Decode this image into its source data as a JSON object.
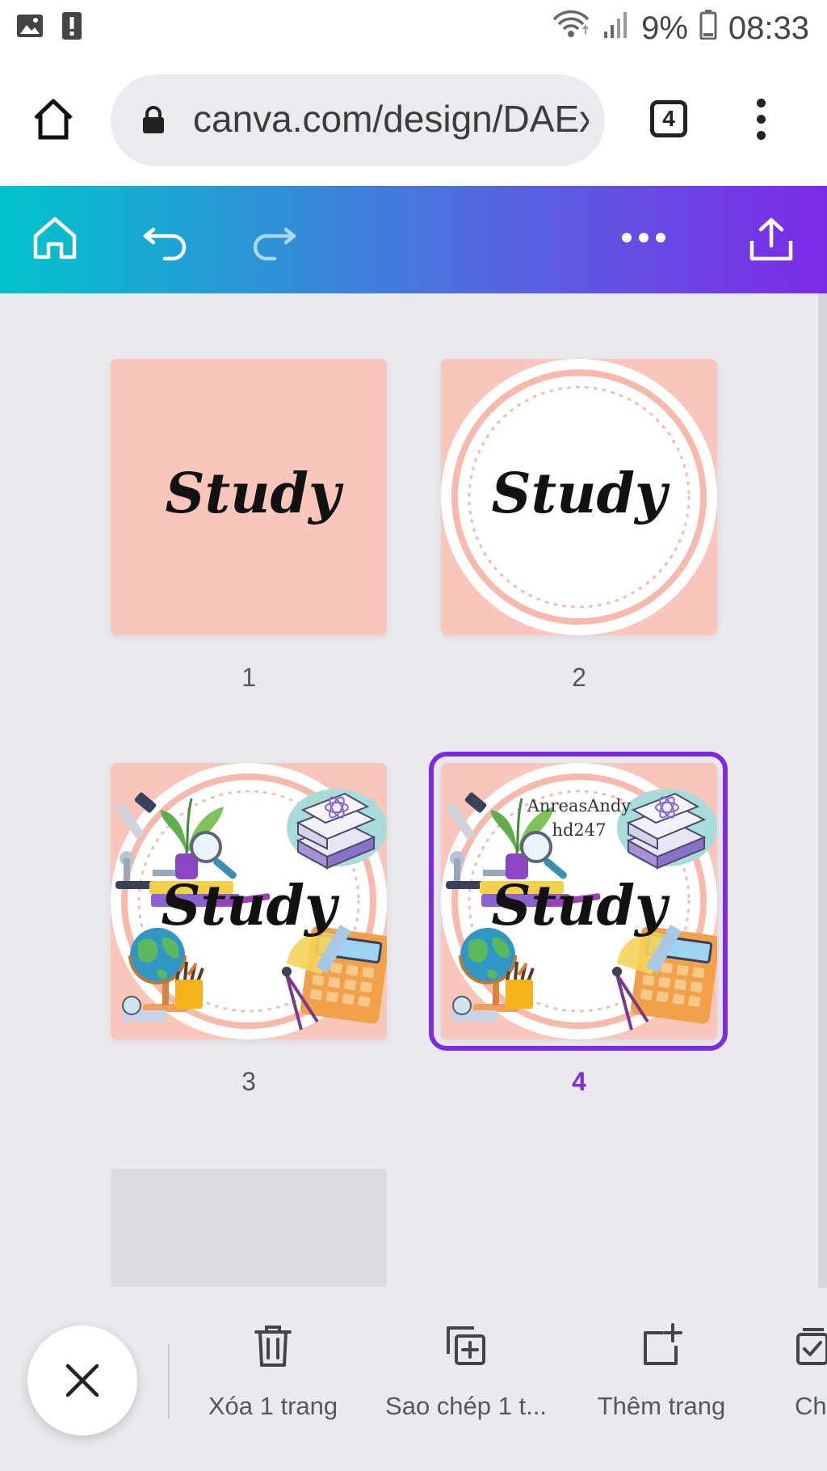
{
  "status_bar": {
    "battery_percent": "9%",
    "time": "08:33",
    "icons": [
      "image-icon",
      "alert-icon",
      "wifi-icon",
      "signal-icon",
      "battery-icon"
    ]
  },
  "browser": {
    "url": "canva.com/design/DAEx",
    "tab_count": "4"
  },
  "canva_toolbar": {
    "icons": [
      "home-icon",
      "undo-icon",
      "redo-icon",
      "more-icon",
      "share-icon"
    ]
  },
  "pages": [
    {
      "number": "1",
      "title": "Study",
      "style": "plain-pink"
    },
    {
      "number": "2",
      "title": "Study",
      "style": "pink-circle"
    },
    {
      "number": "3",
      "title": "Study",
      "style": "study-illustrations"
    },
    {
      "number": "4",
      "title": "Study",
      "style": "study-illustrations",
      "watermark": [
        "AnreasAndy",
        "hd247"
      ],
      "selected": true
    }
  ],
  "bottom_actions": [
    {
      "label": "Xóa 1 trang",
      "icon": "trash-icon"
    },
    {
      "label": "Sao chép 1 t...",
      "icon": "duplicate-icon"
    },
    {
      "label": "Thêm trang",
      "icon": "add-page-icon"
    },
    {
      "label": "Ch",
      "icon": "select-icon"
    }
  ],
  "colors": {
    "accent": "#7d2ae8",
    "gradient_start": "#00c4cc",
    "gradient_end": "#7d2ae8",
    "page_pink": "#fac5ba"
  }
}
